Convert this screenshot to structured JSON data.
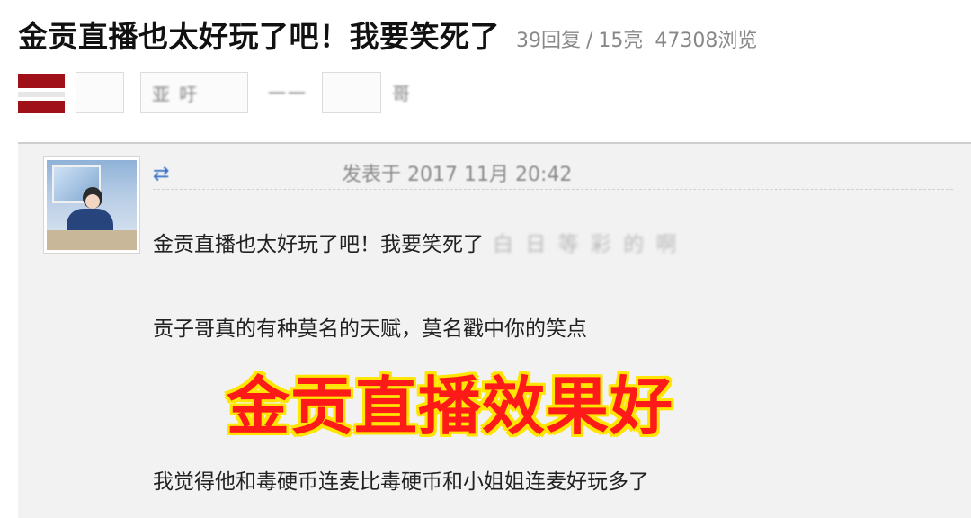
{
  "thread": {
    "title": "金贡直播也太好玩了吧！我要笑死了",
    "replies": "39回复",
    "separator": "/",
    "likes": "15亮",
    "views": "47308浏览"
  },
  "toolbar": {
    "item_a": "亚 吁",
    "item_b": "一一",
    "item_c": "哥"
  },
  "post": {
    "meta_blurred": "发表于 2017 11月 20:42",
    "lines": [
      "金贡直播也太好玩了吧！我要笑死了",
      "贡子哥真的有种莫名的天赋，莫名戳中你的笑点",
      "我觉得他和毒硬币连麦比毒硬币和小姐姐连麦好玩多了"
    ],
    "blurred_tail": "白  日    等  彩  的  啊"
  },
  "overlay": {
    "caption": "金贡直播效果好"
  },
  "colors": {
    "caption_fill": "#ff1a1a",
    "caption_stroke": "#ffe600",
    "flag_red": "#a01019",
    "panel_bg": "#f2f2f2"
  }
}
